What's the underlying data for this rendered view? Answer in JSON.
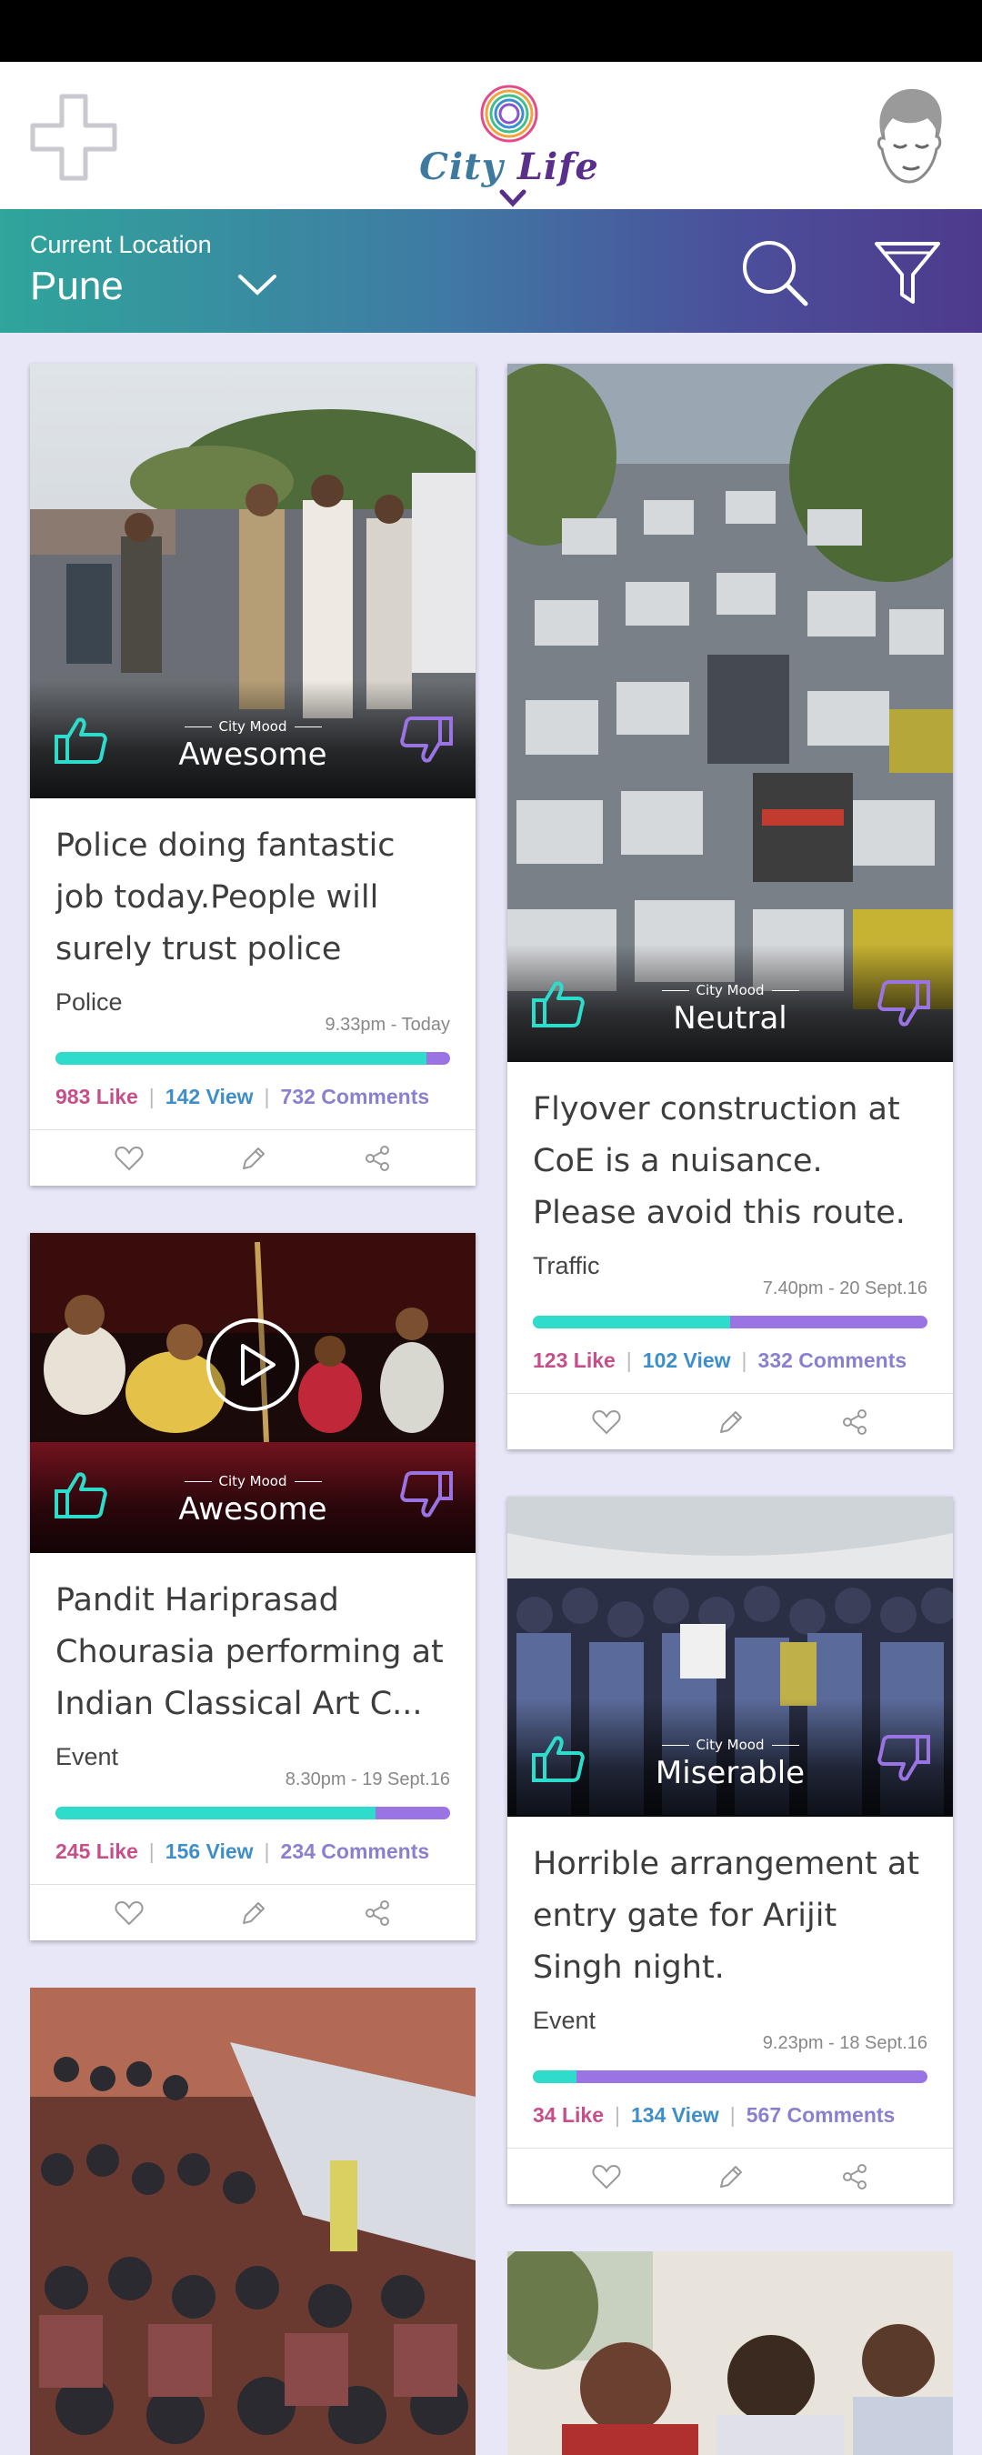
{
  "app": {
    "name_part1": "City",
    "name_part2": "Life"
  },
  "location": {
    "label": "Current Location",
    "city": "Pune"
  },
  "cards": [
    {
      "mood_caption": "City Mood",
      "mood": "Awesome",
      "title": "Police doing fantastic job today.People will surely trust police when...",
      "category": "Police",
      "time": "9.33pm - Today",
      "like_fraction": 0.94,
      "likes": "983 Like",
      "views": "142 View",
      "comments": "732 Comments",
      "image": "police-photo"
    },
    {
      "mood_caption": "City Mood",
      "mood": "Neutral",
      "title": "Flyover construction at CoE is a nuisance. Please avoid this route.",
      "category": "Traffic",
      "time": "7.40pm - 20 Sept.16",
      "like_fraction": 0.5,
      "likes": "123 Like",
      "views": "102 View",
      "comments": "332 Comments",
      "image": "traffic-photo"
    },
    {
      "mood_caption": "City Mood",
      "mood": "Awesome",
      "title": "Pandit Hariprasad Chourasia performing at Indian Classical Art C...",
      "category": "Event",
      "time": "8.30pm - 19 Sept.16",
      "like_fraction": 0.81,
      "likes": "245 Like",
      "views": "156 View",
      "comments": "234 Comments",
      "image": "concert-photo"
    },
    {
      "mood_caption": "City Mood",
      "mood": "Miserable",
      "title": "Horrible arrangement at entry gate for Arijit Singh night.",
      "category": "Event",
      "time": "9.23pm - 18 Sept.16",
      "like_fraction": 0.11,
      "likes": "34 Like",
      "views": "134 View",
      "comments": "567 Comments",
      "image": "crowd-photo"
    }
  ],
  "icons": {
    "add": "plus-icon",
    "avatar": "user-avatar-icon",
    "dropdown": "chevron-down-icon",
    "search": "search-icon",
    "filter": "filter-icon",
    "like": "thumbs-up-icon",
    "dislike": "thumbs-down-icon",
    "heart": "heart-icon",
    "edit": "pencil-icon",
    "share": "share-icon",
    "play": "play-icon"
  },
  "colors": {
    "accent_teal": "#2edccc",
    "accent_purple": "#9b74e3",
    "like": "#c64f8a",
    "view": "#3e8fc9",
    "comments": "#8a80d0"
  }
}
